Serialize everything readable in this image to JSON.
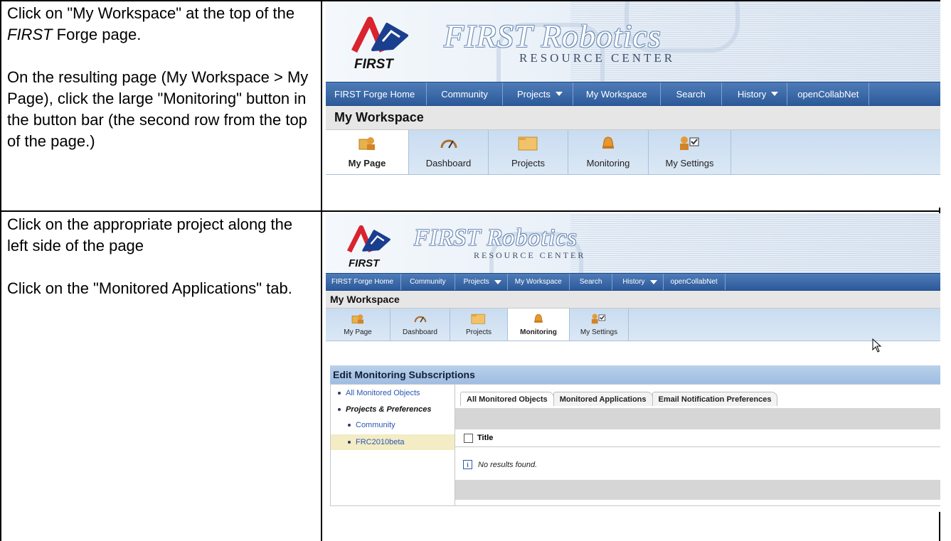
{
  "row1": {
    "paragraph1": [
      "Click on \"My Workspace\" at the top of the ",
      "FIRST",
      " Forge page."
    ],
    "paragraph2": "On the resulting page (My Workspace > My Page), click the large \"Monitoring\" button in the button bar (the second row from the top of the page.)"
  },
  "row2": {
    "paragraph1": "Click on the appropriate project along the left side of the page",
    "paragraph2": "Click on the \"Monitored Applications\" tab."
  },
  "banner": {
    "first_word": "FIRST",
    "robotics": "FIRST Robotics",
    "resource": "RESOURCE CENTER"
  },
  "nav": {
    "items": [
      {
        "label": "FIRST Forge Home",
        "caret": false
      },
      {
        "label": "Community",
        "caret": false
      },
      {
        "label": "Projects",
        "caret": true
      },
      {
        "label": "My Workspace",
        "caret": false
      },
      {
        "label": "Search",
        "caret": false
      },
      {
        "label": "History",
        "caret": true
      },
      {
        "label": "openCollabNet",
        "caret": false
      }
    ]
  },
  "workspace_title": "My Workspace",
  "buttons": [
    "My Page",
    "Dashboard",
    "Projects",
    "Monitoring",
    "My Settings"
  ],
  "monitoring": {
    "header": "Edit Monitoring Subscriptions",
    "sidebar": {
      "all": "All Monitored Objects",
      "projects_prefs": "Projects & Preferences",
      "community": "Community",
      "frc": "FRC2010beta"
    },
    "tabs": [
      "All Monitored Objects",
      "Monitored Applications",
      "Email Notification Preferences"
    ],
    "column_title": "Title",
    "no_results": "No results found.",
    "info_glyph": "i"
  },
  "colors": {
    "nav": "#2c5a9a",
    "button_bar": "#c9dcf0",
    "monitor_header": "#9fbde2",
    "selected_row": "#f3ecc4"
  }
}
